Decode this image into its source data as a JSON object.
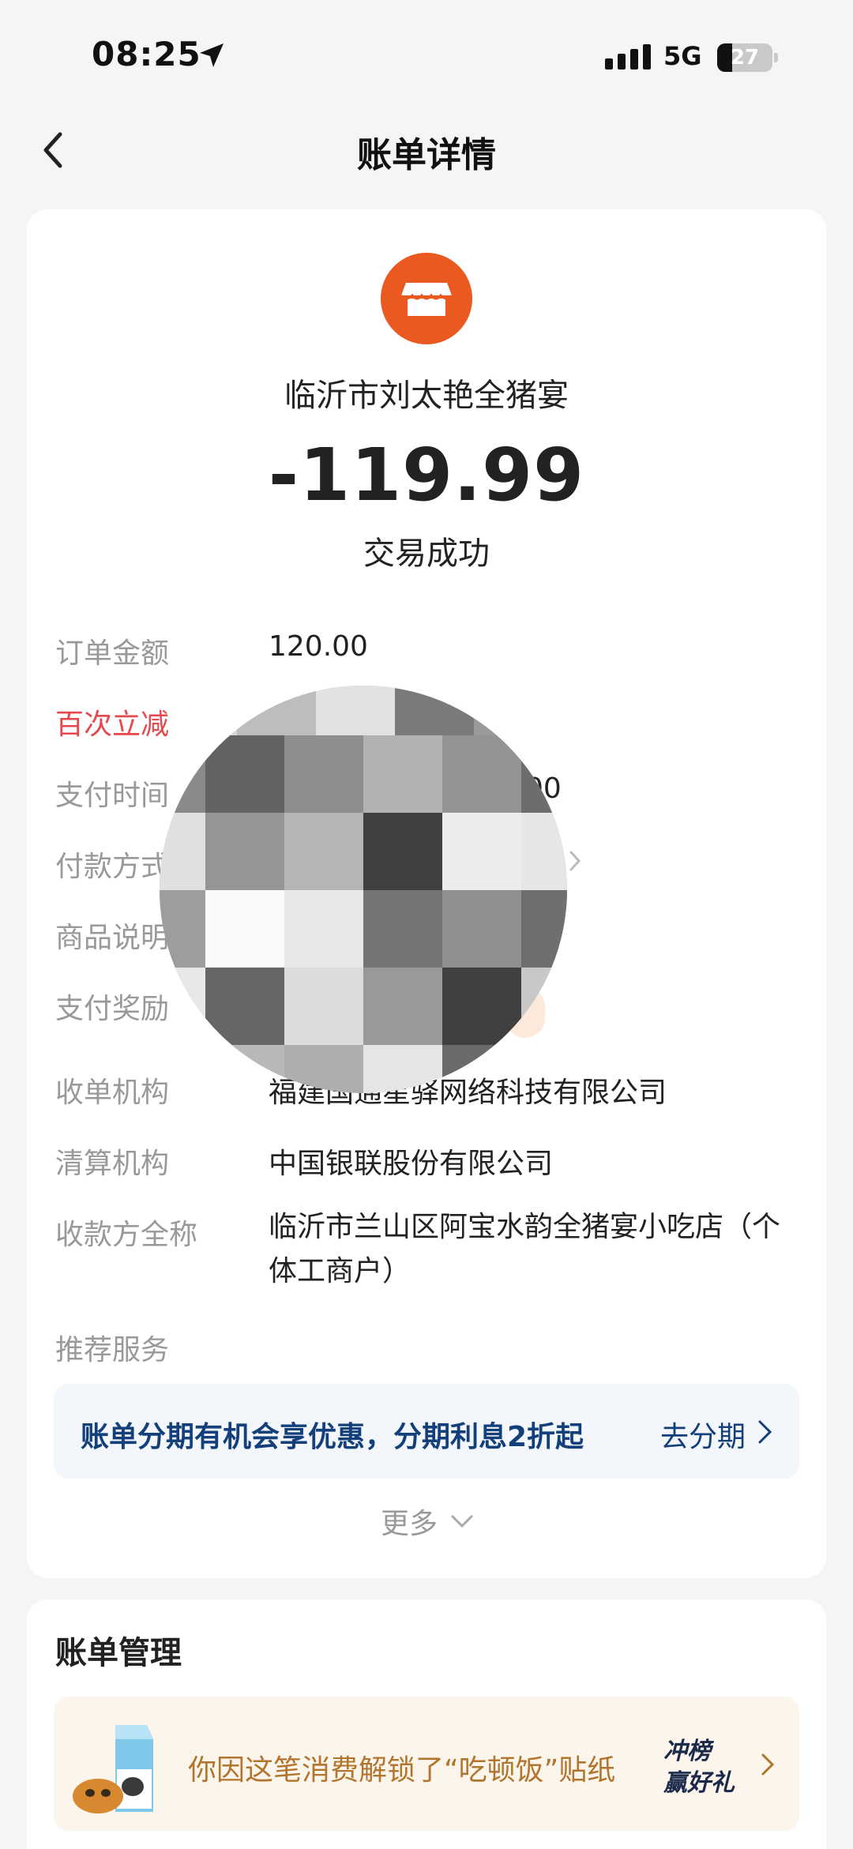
{
  "status_bar": {
    "time": "08:25",
    "network": "5G",
    "battery": "27"
  },
  "nav": {
    "title": "账单详情"
  },
  "merchant": {
    "name": "临沂市刘太艳全猪宴",
    "amount": "-119.99",
    "status": "交易成功"
  },
  "details": [
    {
      "label": "订单金额",
      "value": "120.00"
    },
    {
      "label": "百次立减",
      "value": ""
    },
    {
      "label": "支付时间",
      "value": "00"
    },
    {
      "label": "付款方式",
      "value": ""
    },
    {
      "label": "商品说明",
      "value": ""
    },
    {
      "label": "支付奖励",
      "value": ""
    },
    {
      "label": "收单机构",
      "value": "福建国通星驿网络科技有限公司"
    },
    {
      "label": "清算机构",
      "value": "中国银联股份有限公司"
    },
    {
      "label": "收款方全称",
      "value": "临沂市兰山区阿宝水韵全猪宴小吃店（个体工商户）"
    }
  ],
  "recommend": {
    "label": "推荐服务",
    "banner_text": "账单分期有机会享优惠，分期利息2折起",
    "banner_action": "去分期"
  },
  "more": {
    "label": "更多"
  },
  "bill_management": {
    "title": "账单管理",
    "sticker_text": "你因这笔消费解锁了“吃顿饭”贴纸",
    "badge_line1": "冲榜",
    "badge_line2": "赢好礼"
  },
  "colors": {
    "accent_red": "#e5484d",
    "shop_orange": "#ea5a20",
    "promo_blue": "#13407a",
    "sticker_gold": "#b2752d"
  }
}
